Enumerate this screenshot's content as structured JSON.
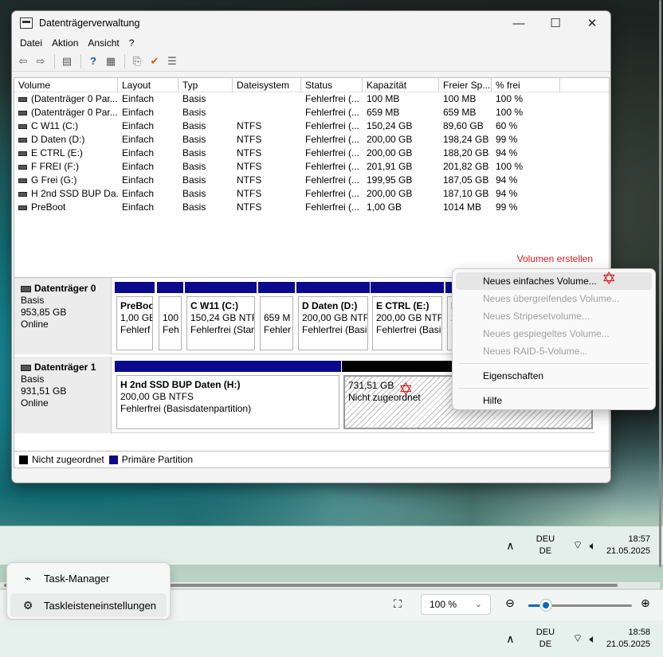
{
  "window": {
    "title": "Datenträgerverwaltung",
    "controls": {
      "minimize": "—",
      "maximize": "☐",
      "close": "✕"
    }
  },
  "menu": [
    "Datei",
    "Aktion",
    "Ansicht",
    "?"
  ],
  "volume_table": {
    "headers": [
      "Volume",
      "Layout",
      "Typ",
      "Dateisystem",
      "Status",
      "Kapazität",
      "Freier Sp...",
      "% frei"
    ],
    "rows": [
      [
        "(Datenträger 0 Par...",
        "Einfach",
        "Basis",
        "",
        "Fehlerfrei (...",
        "100 MB",
        "100 MB",
        "100 %"
      ],
      [
        "(Datenträger 0 Par...",
        "Einfach",
        "Basis",
        "",
        "Fehlerfrei (...",
        "659 MB",
        "659 MB",
        "100 %"
      ],
      [
        "C W11 (C:)",
        "Einfach",
        "Basis",
        "NTFS",
        "Fehlerfrei (...",
        "150,24 GB",
        "89,60 GB",
        "60 %"
      ],
      [
        "D Daten (D:)",
        "Einfach",
        "Basis",
        "NTFS",
        "Fehlerfrei (...",
        "200,00 GB",
        "198,24 GB",
        "99 %"
      ],
      [
        "E CTRL (E:)",
        "Einfach",
        "Basis",
        "NTFS",
        "Fehlerfrei (...",
        "200,00 GB",
        "188,20 GB",
        "94 %"
      ],
      [
        "F FREI (F:)",
        "Einfach",
        "Basis",
        "NTFS",
        "Fehlerfrei (...",
        "201,91 GB",
        "201,82 GB",
        "100 %"
      ],
      [
        "G Frei (G:)",
        "Einfach",
        "Basis",
        "NTFS",
        "Fehlerfrei (...",
        "199,95 GB",
        "187,05 GB",
        "94 %"
      ],
      [
        "H 2nd SSD BUP Da...",
        "Einfach",
        "Basis",
        "NTFS",
        "Fehlerfrei (...",
        "200,00 GB",
        "187,10 GB",
        "94 %"
      ],
      [
        "PreBoot",
        "Einfach",
        "Basis",
        "NTFS",
        "Fehlerfrei (...",
        "1,00 GB",
        "1014 MB",
        "99 %"
      ]
    ],
    "annotation": "Volumen erstellen"
  },
  "disk0": {
    "name": "Datenträger 0",
    "type": "Basis",
    "size": "953,85 GB",
    "state": "Online",
    "parts": [
      {
        "title": "PreBoo",
        "l2": "1,00 GB",
        "l3": "Fehlerf"
      },
      {
        "title": "",
        "l2": "100",
        "l3": "Feh"
      },
      {
        "title": "C W11  (C:)",
        "l2": "150,24 GB NTF",
        "l3": "Fehlerfrei (Star"
      },
      {
        "title": "",
        "l2": "659 M",
        "l3": "Fehler"
      },
      {
        "title": "D Daten  (D:)",
        "l2": "200,00 GB NTF",
        "l3": "Fehlerfrei (Basi"
      },
      {
        "title": "E CTRL  (E:)",
        "l2": "200,00 GB NTF",
        "l3": "Fehlerfrei (Basi"
      },
      {
        "title": "F",
        "l2": "2",
        "l3": "F"
      }
    ]
  },
  "disk1": {
    "name": "Datenträger 1",
    "type": "Basis",
    "size": "931,51 GB",
    "state": "Online",
    "p1": {
      "title": "H 2nd SSD BUP Daten  (H:)",
      "l2": "200,00 GB NTFS",
      "l3": "Fehlerfrei (Basisdatenpartition)"
    },
    "p2": {
      "l1": "731,51 GB",
      "l2": "Nicht zugeordnet"
    }
  },
  "legend": {
    "unalloc": "Nicht zugeordnet",
    "primary": "Primäre Partition",
    "unalloc_color": "#000000",
    "primary_color": "#0a0a8a"
  },
  "context_menu": {
    "items": [
      "Neues einfaches Volume...",
      "Neues übergreifendes Volume...",
      "Neues Stripesetvolume...",
      "Neues gespiegeltes Volume...",
      "Neues RAID-5-Volume...",
      "Eigenschaften",
      "Hilfe"
    ]
  },
  "taskbar_top": {
    "lang1": "DEU",
    "lang2": "DE",
    "time": "18:57",
    "date": "21.05.2025"
  },
  "taskbar_bottom": {
    "lang1": "DEU",
    "lang2": "DE",
    "time": "18:58",
    "date": "21.05.2025"
  },
  "zoom": {
    "value": "100 %",
    "slider_fraction": 0.17
  },
  "taskbar_popup": {
    "item1": "Task-Manager",
    "item2": "Taskleisteneinstellungen"
  }
}
